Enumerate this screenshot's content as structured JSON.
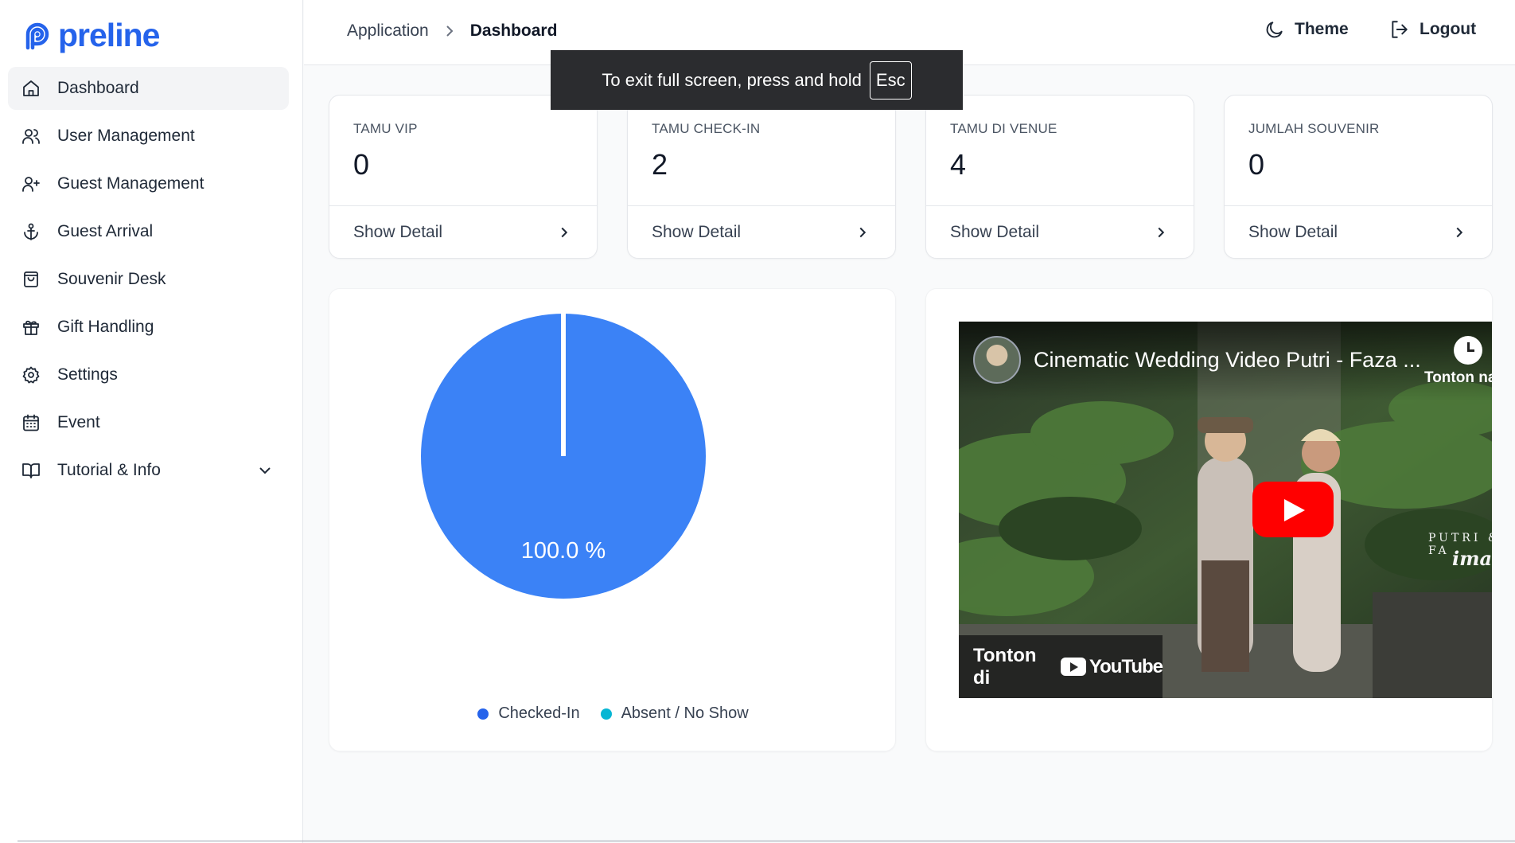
{
  "brand": {
    "name": "preline",
    "color": "#2563eb"
  },
  "sidebar": {
    "items": [
      {
        "label": "Dashboard",
        "icon": "home-icon",
        "active": true
      },
      {
        "label": "User Management",
        "icon": "users-icon"
      },
      {
        "label": "Guest Management",
        "icon": "user-plus-icon"
      },
      {
        "label": "Guest Arrival",
        "icon": "anchor-icon"
      },
      {
        "label": "Souvenir Desk",
        "icon": "shopping-bag-icon"
      },
      {
        "label": "Gift Handling",
        "icon": "gift-icon"
      },
      {
        "label": "Settings",
        "icon": "gear-icon"
      },
      {
        "label": "Event",
        "icon": "calendar-icon"
      },
      {
        "label": "Tutorial & Info",
        "icon": "book-icon",
        "expandable": true
      }
    ]
  },
  "header": {
    "breadcrumb": [
      "Application",
      "Dashboard"
    ],
    "theme_label": "Theme",
    "logout_label": "Logout"
  },
  "toast": {
    "text": "To exit full screen, press and hold",
    "key": "Esc"
  },
  "stats": [
    {
      "label": "TAMU VIP",
      "value": "0",
      "action": "Show Detail"
    },
    {
      "label": "TAMU CHECK-IN",
      "value": "2",
      "action": "Show Detail"
    },
    {
      "label": "TAMU DI VENUE",
      "value": "4",
      "action": "Show Detail"
    },
    {
      "label": "JUMLAH SOUVENIR",
      "value": "0",
      "action": "Show Detail"
    }
  ],
  "chart_data": {
    "type": "pie",
    "categories": [
      "Checked-In",
      "Absent / No Show"
    ],
    "values": [
      100.0,
      0.0
    ],
    "colors": [
      "#3b82f6",
      "#06b6d4"
    ],
    "legend_colors": [
      "#2563eb",
      "#06b6d4"
    ],
    "data_labels": [
      "100.0 %"
    ],
    "legend_position": "bottom"
  },
  "video": {
    "title": "Cinematic Wedding Video Putri - Faza ...",
    "watch_later": "Tonton nanti",
    "watch_on": "Tonton di",
    "platform": "YouTube",
    "watermark_line1": "PUTRI & FA",
    "watermark_line2": "imagen"
  }
}
